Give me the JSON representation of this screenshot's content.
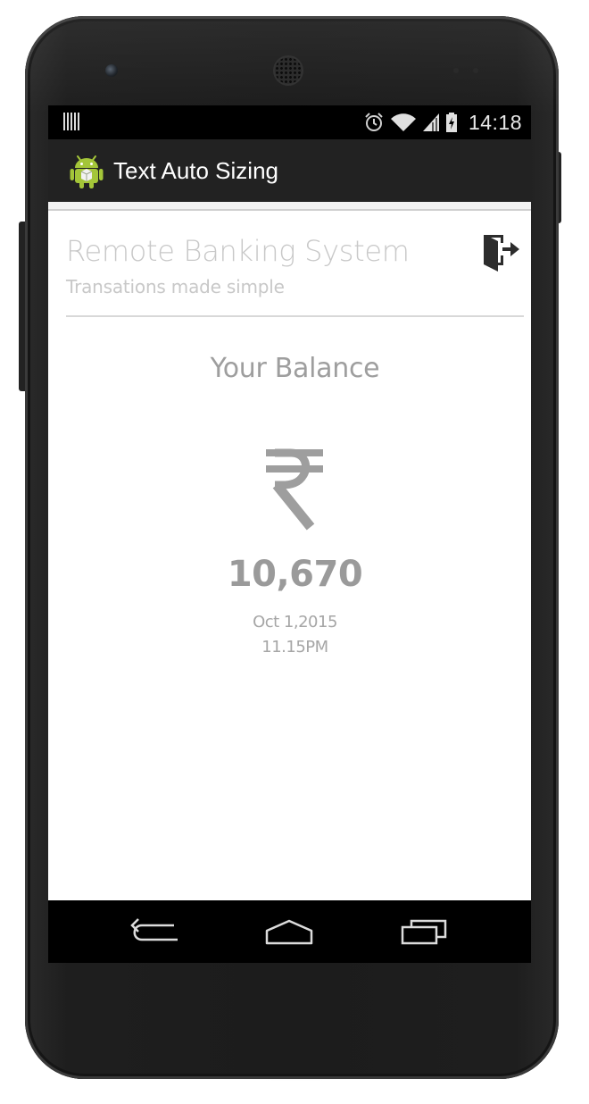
{
  "status_bar": {
    "time": "14:18",
    "icons": [
      "notification-barcode-icon",
      "alarm-icon",
      "wifi-icon",
      "signal-icon",
      "battery-icon"
    ]
  },
  "action_bar": {
    "title": "Text Auto Sizing",
    "icon": "android-icon"
  },
  "header": {
    "title": "Remote Banking System",
    "subtitle": "Transations made simple",
    "logout_icon": "logout-icon"
  },
  "balance": {
    "label": "Your Balance",
    "currency_icon": "rupee-icon",
    "amount": "10,670",
    "date": "Oct 1,2015",
    "time": "11.15PM"
  },
  "nav_bar": {
    "buttons": [
      "back-icon",
      "home-icon",
      "recent-apps-icon"
    ]
  },
  "colors": {
    "status_bar_bg": "#000000",
    "action_bar_bg": "#222222",
    "light_text": "#c8c8c8",
    "balance_text": "#9a9a9a",
    "rupee_color": "#9e9e9e",
    "app_icon_green": "#a4c639"
  }
}
